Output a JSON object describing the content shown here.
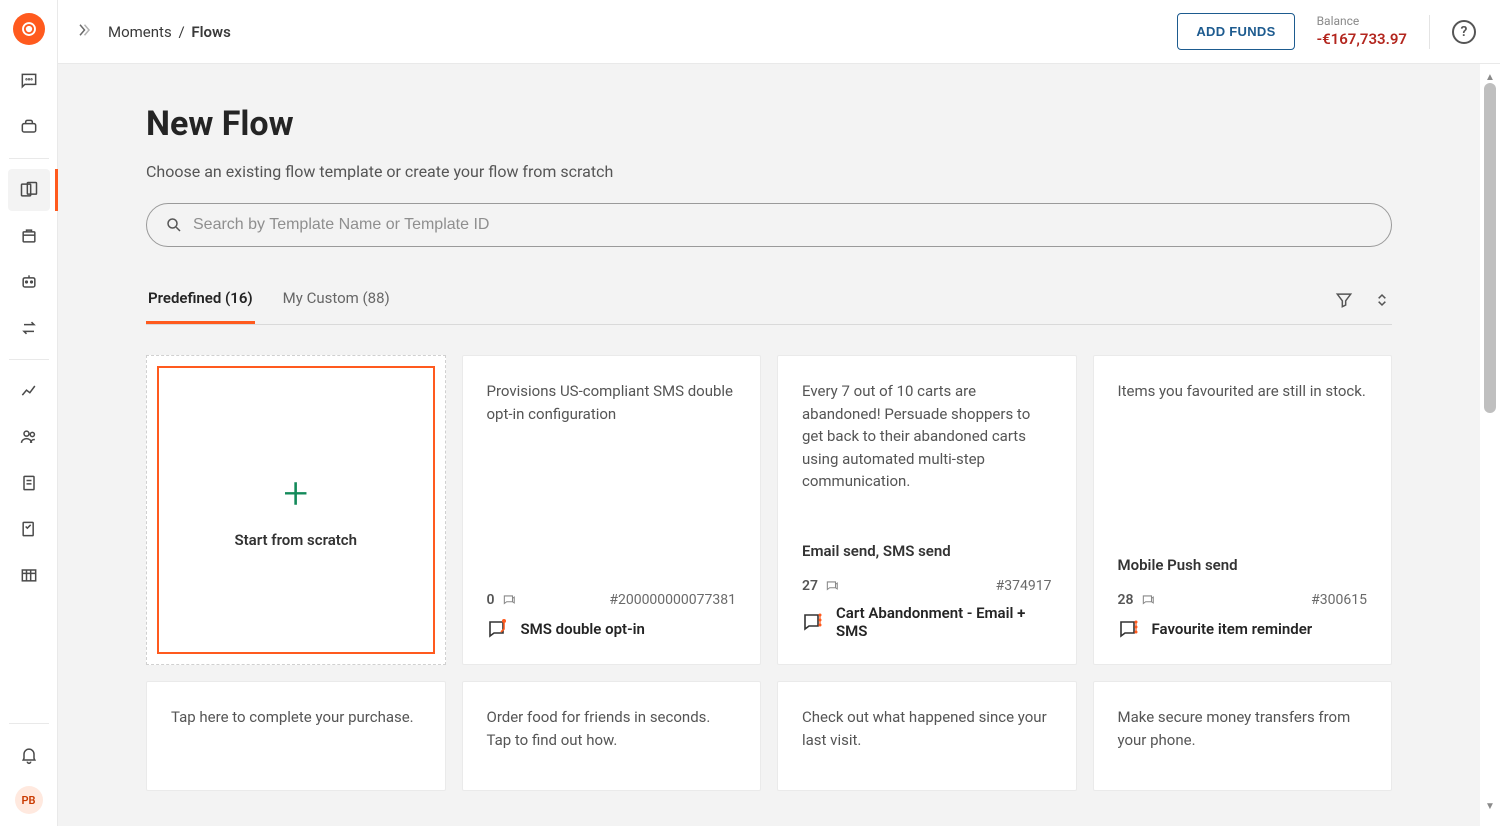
{
  "sidebar": {
    "avatar_initials": "PB"
  },
  "breadcrumb": {
    "parent": "Moments",
    "sep": "/",
    "current": "Flows"
  },
  "topbar": {
    "add_funds_label": "ADD FUNDS",
    "balance_label": "Balance",
    "balance_value": "-€167,733.97"
  },
  "page": {
    "title": "New Flow",
    "subtitle": "Choose an existing flow template or create your flow from scratch"
  },
  "search": {
    "placeholder": "Search by Template Name or Template ID"
  },
  "tabs": {
    "predefined": "Predefined (16)",
    "my_custom": "My Custom (88)"
  },
  "cards": {
    "scratch_label": "Start from scratch",
    "c1": {
      "desc": "Provisions US-compliant SMS double opt-in configuration",
      "count": "0",
      "id": "#200000000077381",
      "title": "SMS double opt-in"
    },
    "c2": {
      "desc": "Every 7 out of 10 carts are abandoned! Persuade shoppers to get back to their abandoned carts using automated multi-step communication.",
      "subline": "Email send, SMS send",
      "count": "27",
      "id": "#374917",
      "title": "Cart Abandonment - Email + SMS"
    },
    "c3": {
      "desc": "Items you favourited are still in stock.",
      "subline": "Mobile Push send",
      "count": "28",
      "id": "#300615",
      "title": "Favourite item reminder"
    },
    "r2": {
      "a": "Tap here to complete your purchase.",
      "b": "Order food for friends in seconds. Tap to find out how.",
      "c": "Check out what happened since your last visit.",
      "d": "Make secure money transfers from your phone."
    }
  }
}
